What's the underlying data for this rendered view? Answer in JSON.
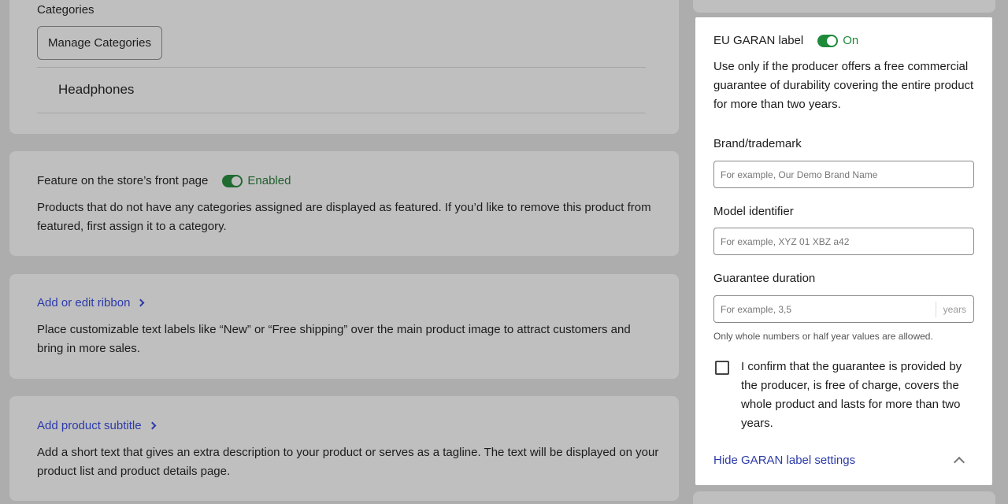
{
  "categories": {
    "title": "Categories",
    "manage_button": "Manage Categories",
    "items": [
      "Headphones"
    ]
  },
  "featured": {
    "label": "Feature on the store’s front page",
    "status": "Enabled",
    "description": "Products that do not have any categories assigned are displayed as featured. If you’d like to remove this product from featured, first assign it to a category."
  },
  "ribbon": {
    "link": "Add or edit ribbon",
    "description": "Place customizable text labels like “New” or “Free shipping” over the main product image to attract customers and bring in more sales."
  },
  "subtitle": {
    "link": "Add product subtitle",
    "description": "Add a short text that gives an extra description to your product or serves as a tagline. The text will be displayed on your product list and product details page."
  },
  "garan": {
    "label": "EU GARAN label",
    "status": "On",
    "description": "Use only if the producer offers a free commercial guarantee of durability covering the entire product for more than two years.",
    "brand_label": "Brand/trademark",
    "brand_placeholder": "For example, Our Demo Brand Name",
    "model_label": "Model identifier",
    "model_placeholder": "For example, XYZ 01 XBZ a42",
    "duration_label": "Guarantee duration",
    "duration_placeholder": "For example, 3,5",
    "duration_suffix": "years",
    "hint": "Only whole numbers or half year values are allowed.",
    "confirm_text": "I confirm that the guarantee is provided by the producer, is free of charge, covers the whole product and lasts for more than two years.",
    "hide_link": "Hide GARAN label settings"
  },
  "colors": {
    "link": "#2c3aa8",
    "toggle_on": "#1f8a3a"
  }
}
